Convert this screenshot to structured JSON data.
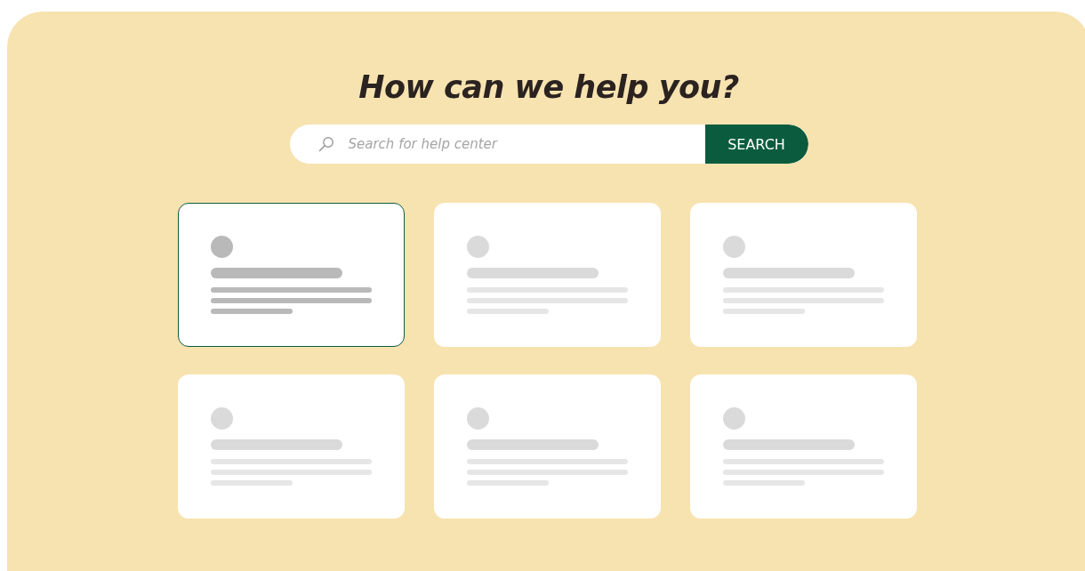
{
  "title": "How can we help you?",
  "search": {
    "placeholder": "Search for help center",
    "button": "SEARCH"
  },
  "cards": [
    {
      "selected": true
    },
    {
      "selected": false
    },
    {
      "selected": false
    },
    {
      "selected": false
    },
    {
      "selected": false
    },
    {
      "selected": false
    }
  ]
}
